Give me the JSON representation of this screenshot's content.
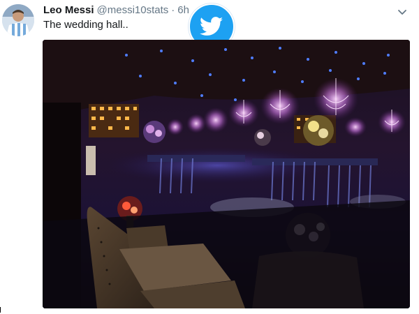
{
  "tweet": {
    "author_name": "Leo Messi",
    "handle": "@messi10stats",
    "separator": "·",
    "time": "6h",
    "text": "The wedding hall..",
    "menu_icon": "chevron-down-icon",
    "badge_icon": "twitter-bird-icon"
  },
  "colors": {
    "twitter_blue": "#1da1f2",
    "secondary_text": "#657786",
    "primary_text": "#14171a"
  }
}
